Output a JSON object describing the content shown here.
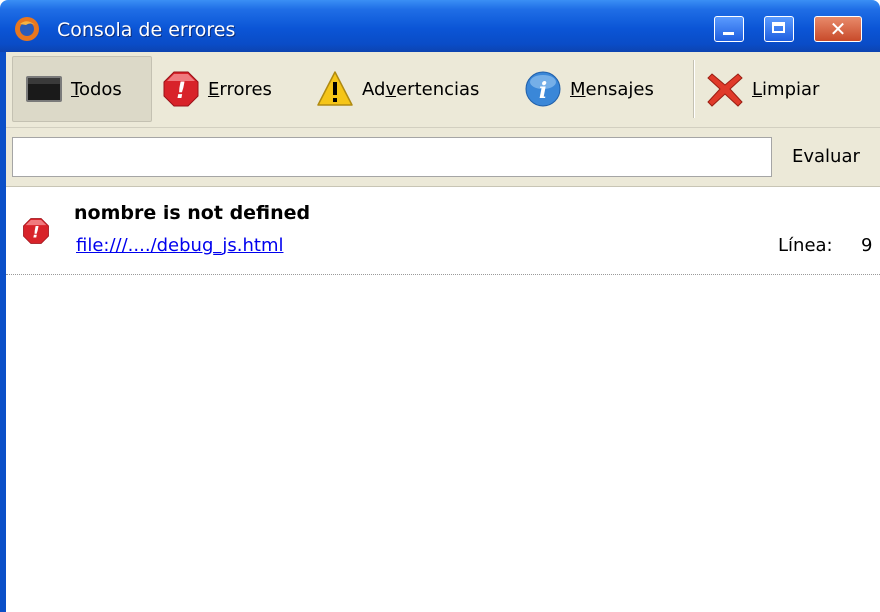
{
  "window": {
    "title": "Consola de errores",
    "close_glyph": "✕"
  },
  "toolbar": {
    "buttons": [
      {
        "label_prefix": "",
        "mnemonic": "T",
        "label_rest": "odos",
        "icon": "console-icon"
      },
      {
        "label_prefix": "",
        "mnemonic": "E",
        "label_rest": "rrores",
        "icon": "error-icon"
      },
      {
        "label_prefix": "Ad",
        "mnemonic": "v",
        "label_rest": "ertencias",
        "icon": "warning-icon"
      },
      {
        "label_prefix": "",
        "mnemonic": "M",
        "label_rest": "ensajes",
        "icon": "info-icon"
      },
      {
        "label_prefix": "",
        "mnemonic": "L",
        "label_rest": "impiar",
        "icon": "clear-icon"
      }
    ]
  },
  "eval": {
    "input_value": "",
    "button_label": "Evaluar"
  },
  "messages": [
    {
      "type": "error",
      "title": "nombre is not defined",
      "source": "file:///..../debug_js.html",
      "line_label": "Línea:",
      "line_number": "9"
    }
  ],
  "colors": {
    "title_bar": "#0b55d6",
    "toolbar_bg": "#ece9d8",
    "link": "#0000ee",
    "error_red": "#d8232a",
    "warning_yellow": "#f5c518",
    "info_blue": "#3a87d8"
  }
}
